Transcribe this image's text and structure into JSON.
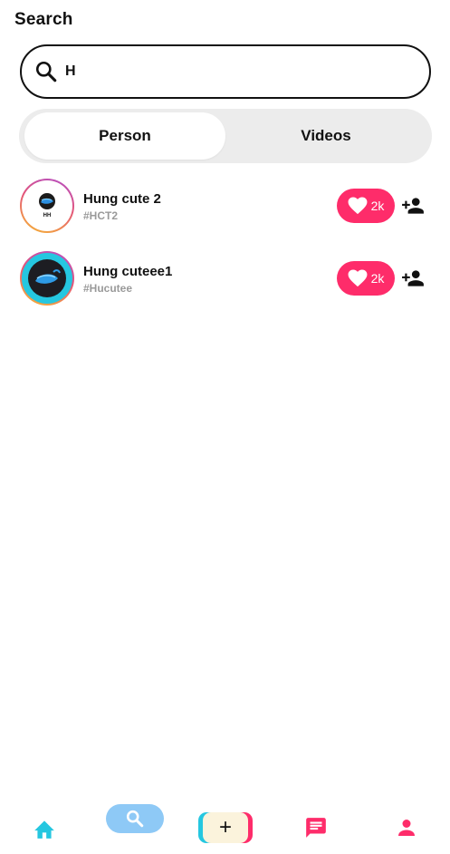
{
  "header": {
    "title": "Search"
  },
  "search": {
    "value": "H",
    "icon": "search-icon"
  },
  "tabs": [
    {
      "label": "Person",
      "active": true
    },
    {
      "label": "Videos",
      "active": false
    }
  ],
  "results": [
    {
      "name": "Hung cute 2",
      "handle": "#HCT2",
      "likes": "2k",
      "avatar": "whale-logo-small"
    },
    {
      "name": "Hung cuteee1",
      "handle": "#Hucutee",
      "likes": "2k",
      "avatar": "whale-logo-dark"
    }
  ],
  "bottom_nav": {
    "items": [
      "home-icon",
      "search-icon",
      "create-plus-icon",
      "chat-icon",
      "profile-icon"
    ],
    "create_symbol": "+",
    "active": "search"
  },
  "colors": {
    "accent_pink": "#fe2c6a",
    "accent_cyan": "#25c7e0",
    "search_pill": "#8ec9f6",
    "tab_background": "#ececec",
    "handle_gray": "#9a9a9a"
  }
}
